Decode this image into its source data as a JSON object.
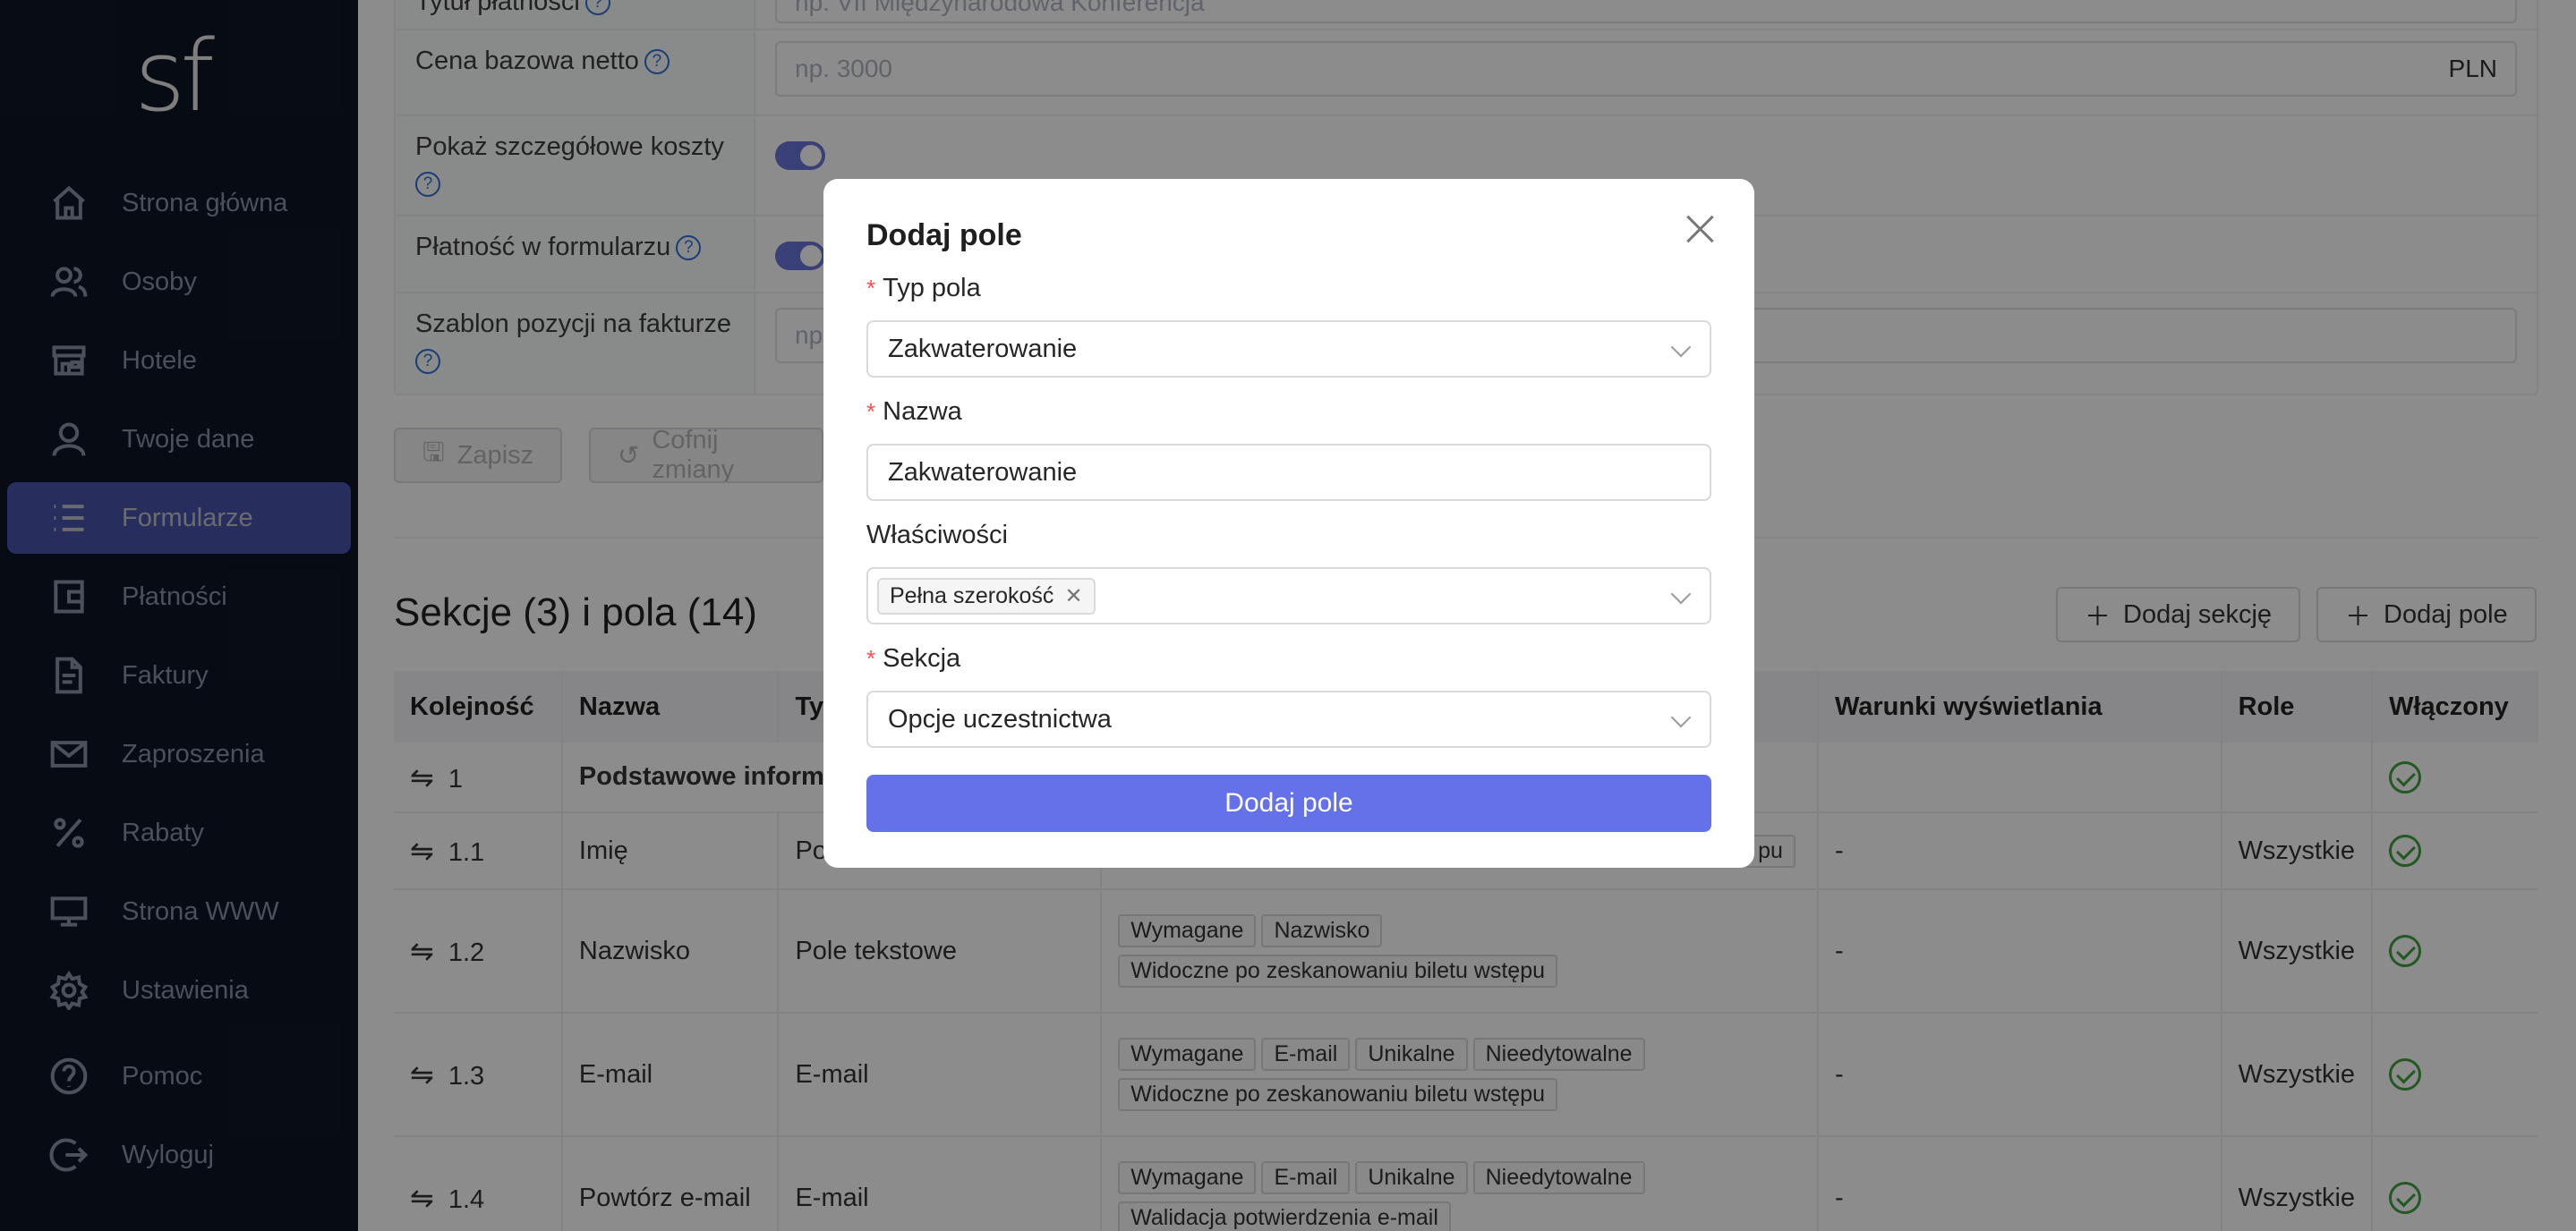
{
  "sidebar": {
    "logo": "sf",
    "items": [
      {
        "label": "Strona główna",
        "icon": "home-icon"
      },
      {
        "label": "Osoby",
        "icon": "people-icon"
      },
      {
        "label": "Hotele",
        "icon": "shop-icon"
      },
      {
        "label": "Twoje dane",
        "icon": "user-icon"
      },
      {
        "label": "Formularze",
        "icon": "list-icon",
        "active": true
      },
      {
        "label": "Płatności",
        "icon": "wallet-icon"
      },
      {
        "label": "Faktury",
        "icon": "document-icon"
      },
      {
        "label": "Zaproszenia",
        "icon": "mail-icon"
      },
      {
        "label": "Rabaty",
        "icon": "percent-icon"
      },
      {
        "label": "Strona WWW",
        "icon": "desktop-icon"
      },
      {
        "label": "Ustawienia",
        "icon": "gear-icon"
      },
      {
        "label": "Pomoc",
        "icon": "question-icon"
      },
      {
        "label": "Wyloguj",
        "icon": "logout-icon"
      }
    ]
  },
  "settings": {
    "rows": [
      {
        "label": "Tytuł płatności",
        "placeholder": "np. VII Międzynarodowa Konferencja"
      },
      {
        "label": "Cena bazowa netto",
        "placeholder": "np. 3000",
        "suffix": "PLN"
      },
      {
        "label": "Pokaż szczegółowe koszty"
      },
      {
        "label": "Płatność w formularzu"
      },
      {
        "label": "Szablon pozycji na fakturze",
        "placeholder": "np"
      }
    ],
    "save_label": "Zapisz",
    "undo_label": "Cofnij zmiany"
  },
  "sections": {
    "title": "Sekcje (3) i pola (14)",
    "add_section_label": "Dodaj sekcję",
    "add_field_label": "Dodaj pole",
    "columns": [
      "Kolejność",
      "Nazwa",
      "Ty",
      "",
      "Warunki wyświetlania",
      "Role",
      "Włączony"
    ],
    "rows": [
      {
        "order": "1",
        "name": "Podstawowe inform",
        "type": "",
        "tags": [],
        "conditions": "",
        "role": ""
      },
      {
        "order": "1.1",
        "name": "Imię",
        "type": "Po",
        "tags": [
          "pu"
        ],
        "conditions": "-",
        "role": "Wszystkie"
      },
      {
        "order": "1.2",
        "name": "Nazwisko",
        "type": "Pole tekstowe",
        "tags": [
          "Wymagane",
          "Nazwisko",
          "Widoczne po zeskanowaniu biletu wstępu"
        ],
        "conditions": "-",
        "role": "Wszystkie"
      },
      {
        "order": "1.3",
        "name": "E-mail",
        "type": "E-mail",
        "tags": [
          "Wymagane",
          "E-mail",
          "Unikalne",
          "Nieedytowalne",
          "Widoczne po zeskanowaniu biletu wstępu"
        ],
        "conditions": "-",
        "role": "Wszystkie"
      },
      {
        "order": "1.4",
        "name": "Powtórz e-mail",
        "type": "E-mail",
        "tags": [
          "Wymagane",
          "E-mail",
          "Unikalne",
          "Nieedytowalne",
          "Walidacja potwierdzenia e-mail"
        ],
        "conditions": "-",
        "role": "Wszystkie"
      }
    ]
  },
  "modal": {
    "title": "Dodaj pole",
    "type_label": "Typ pola",
    "type_value": "Zakwaterowanie",
    "name_label": "Nazwa",
    "name_value": "Zakwaterowanie",
    "props_label": "Właściwości",
    "props_tag": "Pełna szerokość",
    "section_label": "Sekcja",
    "section_value": "Opcje uczestnictwa",
    "submit_label": "Dodaj pole",
    "required_mark": "*"
  },
  "colors": {
    "sidebar_bg": "#0d1526",
    "accent": "#6571e8",
    "success": "#3fa33f",
    "required": "#ff4d4f"
  }
}
